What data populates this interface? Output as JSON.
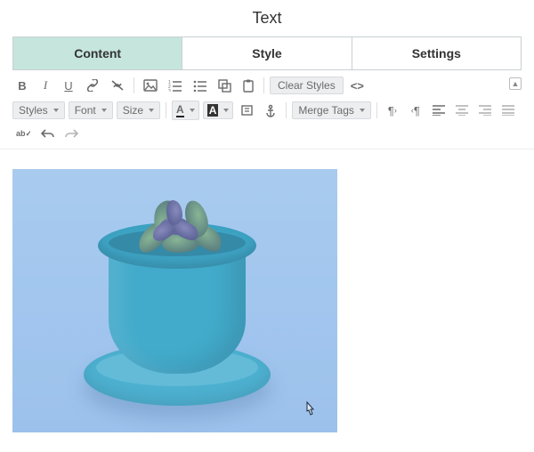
{
  "title": "Text",
  "tabs": [
    {
      "label": "Content",
      "active": true
    },
    {
      "label": "Style",
      "active": false
    },
    {
      "label": "Settings",
      "active": false
    }
  ],
  "toolbar": {
    "clear_styles": "Clear Styles"
  },
  "toolbar2": {
    "styles": "Styles",
    "font": "Font",
    "size": "Size",
    "text_color_letter": "A",
    "bg_color_letter": "A",
    "merge_tags": "Merge Tags"
  }
}
